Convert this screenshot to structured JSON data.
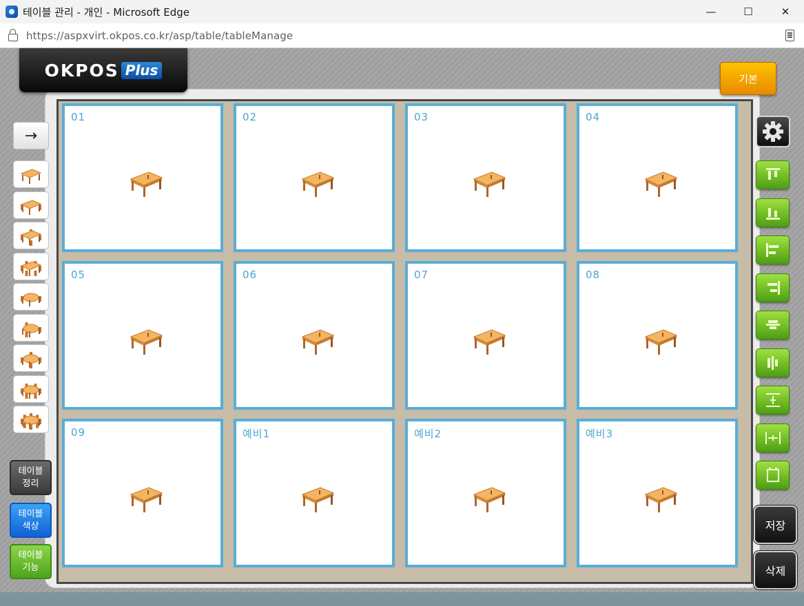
{
  "window": {
    "title": "테이블 관리 - 개인 - Microsoft Edge",
    "minimize": "—",
    "maximize": "☐",
    "close": "✕"
  },
  "address": {
    "url": "https://aspxvirt.okpos.co.kr/asp/table/tableManage"
  },
  "logo": {
    "main": "OKPOS",
    "plus": "Plus"
  },
  "header": {
    "basic_label": "기본"
  },
  "left_toolbar": {
    "arrow": "→",
    "table_types": [
      "table-1",
      "table-2-chairs",
      "table-4-chairs",
      "table-6-chairs",
      "round-table-2",
      "round-table-3",
      "round-table-4",
      "round-table-6",
      "round-table-8"
    ],
    "arrange": [
      "테이블",
      "정리"
    ],
    "color": [
      "테이블",
      "색상"
    ],
    "function": [
      "테이블",
      "기능"
    ]
  },
  "tables": [
    {
      "label": "01"
    },
    {
      "label": "02"
    },
    {
      "label": "03"
    },
    {
      "label": "04"
    },
    {
      "label": "05"
    },
    {
      "label": "06"
    },
    {
      "label": "07"
    },
    {
      "label": "08"
    },
    {
      "label": "09"
    },
    {
      "label": "예비1"
    },
    {
      "label": "예비2"
    },
    {
      "label": "예비3"
    }
  ],
  "right_toolbar": {
    "align_tools": [
      "align-top",
      "align-bottom",
      "align-left",
      "align-right",
      "align-center-vertical",
      "align-center-horizontal",
      "distribute-vertical",
      "distribute-horizontal",
      "same-size"
    ],
    "save_label": "저장",
    "delete_label": "삭제"
  },
  "colors": {
    "table_border": "#59add8",
    "table_label": "#4aa4d4",
    "basic_button": "#ffb300",
    "align_button": "#6cbc22"
  }
}
